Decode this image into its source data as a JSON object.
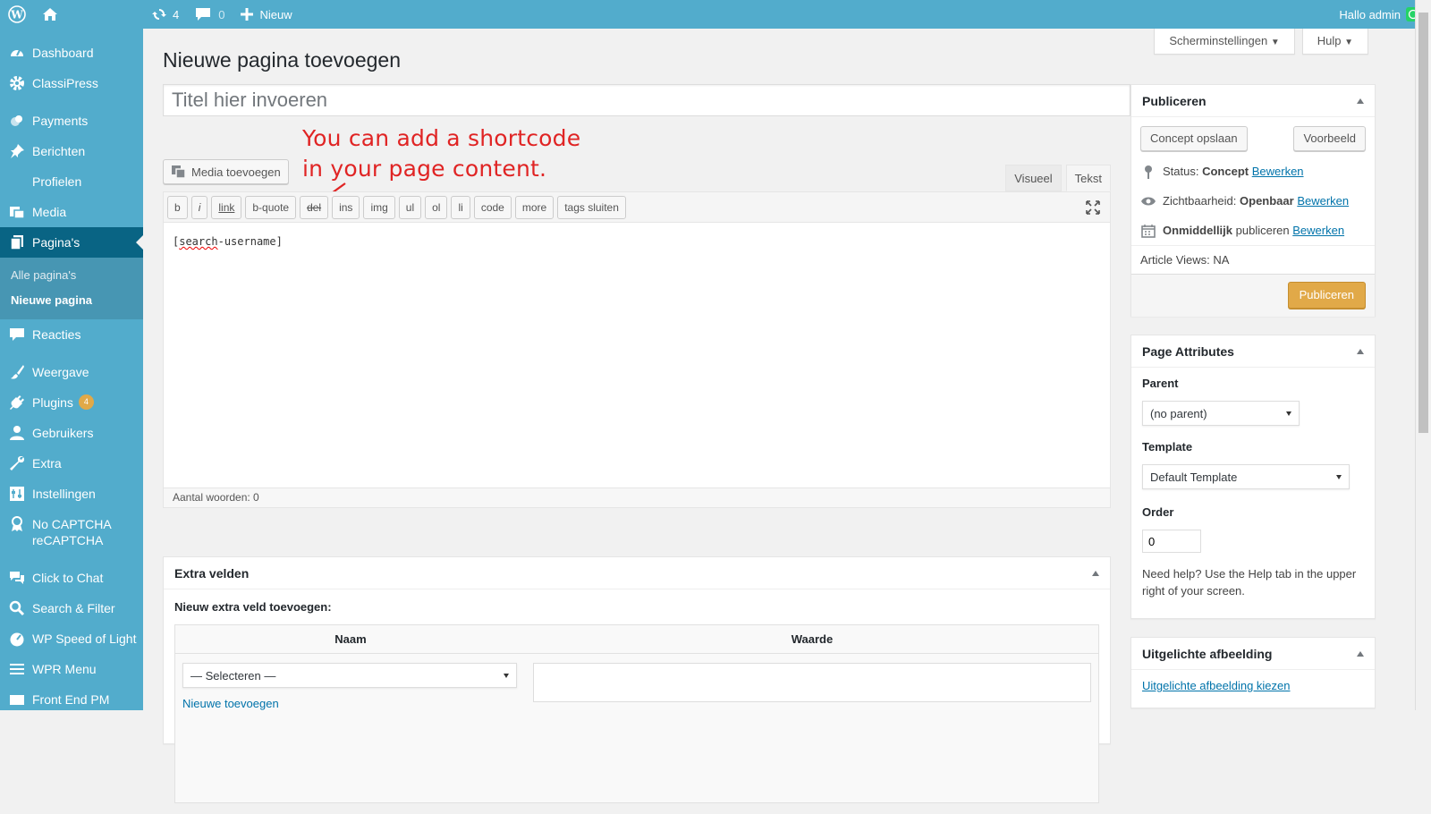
{
  "adminbar": {
    "updates": "4",
    "comments": "0",
    "new_label": "Nieuw",
    "greeting": "Hallo admin"
  },
  "menu": {
    "items": [
      {
        "label": "Dashboard",
        "icon": "dashboard-icon"
      },
      {
        "label": "ClassiPress",
        "icon": "gear-icon"
      },
      {
        "label": "Payments",
        "icon": "coins-icon"
      },
      {
        "label": "Berichten",
        "icon": "pin-icon"
      },
      {
        "label": "Profielen",
        "icon": ""
      },
      {
        "label": "Media",
        "icon": "media-icon"
      },
      {
        "label": "Pagina's",
        "icon": "pages-icon"
      },
      {
        "label": "Reacties",
        "icon": "comment-icon"
      },
      {
        "label": "Weergave",
        "icon": "brush-icon"
      },
      {
        "label": "Plugins",
        "icon": "plug-icon",
        "badge": "4"
      },
      {
        "label": "Gebruikers",
        "icon": "user-icon"
      },
      {
        "label": "Extra",
        "icon": "wrench-icon"
      },
      {
        "label": "Instellingen",
        "icon": "settings-icon"
      },
      {
        "label": "No CAPTCHA reCAPTCHA",
        "icon": "award-icon"
      },
      {
        "label": "Click to Chat",
        "icon": "chat-icon"
      },
      {
        "label": "Search & Filter",
        "icon": "search-icon"
      },
      {
        "label": "WP Speed of Light",
        "icon": "speed-icon"
      },
      {
        "label": "WPR Menu",
        "icon": "hamburger-icon"
      },
      {
        "label": "Front End PM",
        "icon": "mail-icon"
      }
    ],
    "sub": {
      "all": "Alle pagina's",
      "new": "Nieuwe pagina"
    }
  },
  "screen_options": "Scherminstellingen",
  "help": "Hulp",
  "page_title": "Nieuwe pagina toevoegen",
  "title_placeholder": "Titel hier invoeren",
  "annotation": {
    "line1": "You can add a shortcode",
    "line2": "in your page content."
  },
  "editor": {
    "media_button": "Media toevoegen",
    "tab_visual": "Visueel",
    "tab_text": "Tekst",
    "quicktags": [
      "b",
      "i",
      "link",
      "b-quote",
      "del",
      "ins",
      "img",
      "ul",
      "ol",
      "li",
      "code",
      "more",
      "tags sluiten"
    ],
    "content_spell": "search",
    "content_rest": "-username]",
    "content_open": "[",
    "word_count": "Aantal woorden: 0"
  },
  "extra_fields": {
    "title": "Extra velden",
    "add_label": "Nieuw extra veld toevoegen:",
    "col_name": "Naam",
    "col_value": "Waarde",
    "select_placeholder": "— Selecteren —",
    "add_new": "Nieuwe toevoegen"
  },
  "publish": {
    "title": "Publiceren",
    "save_draft": "Concept opslaan",
    "preview": "Voorbeeld",
    "status_label": "Status:",
    "status_value": "Concept",
    "edit": "Bewerken",
    "visibility_label": "Zichtbaarheid:",
    "visibility_value": "Openbaar",
    "immediately": "Onmiddellijk",
    "publish_word": "publiceren",
    "article_views": "Article Views: NA",
    "publish_button": "Publiceren"
  },
  "page_attributes": {
    "title": "Page Attributes",
    "parent_label": "Parent",
    "parent_value": "(no parent)",
    "template_label": "Template",
    "template_value": "Default Template",
    "order_label": "Order",
    "order_value": "0",
    "help": "Need help? Use the Help tab in the upper right of your screen."
  },
  "featured": {
    "title": "Uitgelichte afbeelding",
    "link": "Uitgelichte afbeelding kiezen"
  },
  "colors": {
    "menu": "#52accc",
    "menu_current": "#096484",
    "publish": "#e1a948",
    "annotation": "#e02424"
  }
}
